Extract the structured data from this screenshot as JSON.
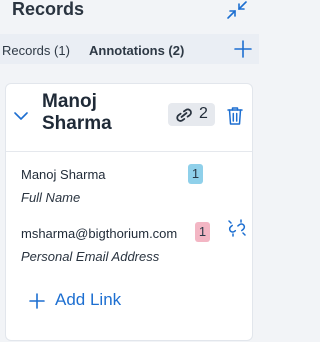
{
  "panel": {
    "title": "Records"
  },
  "tabs": [
    {
      "label": "Records (1)"
    },
    {
      "label": "Annotations (2)"
    }
  ],
  "record": {
    "name": "Manoj Sharma",
    "link_count": "2",
    "fields": [
      {
        "value": "Manoj Sharma",
        "label": "Full Name",
        "badge": "1",
        "badge_color": "#8fd0ea"
      },
      {
        "value": "msharma@bigthorium.com",
        "label": "Personal Email Address",
        "badge": "1",
        "badge_color": "#f3b6c4"
      }
    ],
    "add_link_label": "Add Link"
  },
  "icons": {
    "collapse": "collapse-arrows-icon",
    "add": "plus-icon",
    "chevron": "chevron-down-icon",
    "link": "link-icon",
    "trash": "trash-icon",
    "unlink": "unlink-icon"
  },
  "colors": {
    "accent": "#1d6fd1",
    "background": "#f2f4f7"
  }
}
